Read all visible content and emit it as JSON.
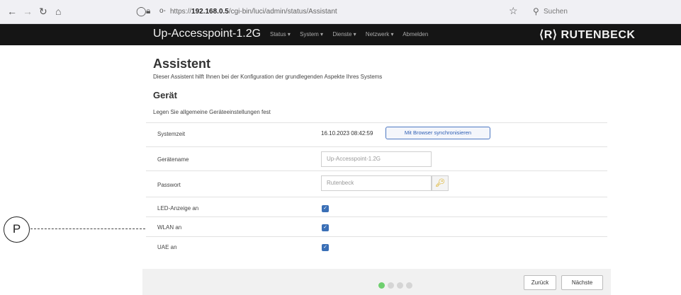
{
  "browser": {
    "url_prefix": "https://",
    "url_host": "192.168.0.5",
    "url_path": "/cgi-bin/luci/admin/status/Assistant",
    "search_placeholder": "Suchen"
  },
  "navbar": {
    "brand": "Up-Accesspoint-1.2G",
    "menu": [
      "Status ▾",
      "System ▾",
      "Dienste ▾",
      "Netzwerk ▾",
      "Abmelden"
    ],
    "logo": "⟨R⟩ RUTENBECK"
  },
  "page": {
    "title": "Assistent",
    "subtitle": "Dieser Assistent hilft Ihnen bei der Konfiguration der grundlegenden Aspekte Ihres Systems",
    "section_title": "Gerät",
    "section_desc": "Legen Sie allgemeine Geräteeinstellungen fest"
  },
  "form": {
    "systemzeit_label": "Systemzeit",
    "systemzeit_value": "16.10.2023 08:42:59",
    "sync_button": "Mit Browser synchronisieren",
    "geraetename_label": "Gerätename",
    "geraetename_value": "Up-Accesspoint-1.2G",
    "passwort_label": "Passwort",
    "passwort_value": "Rutenbeck",
    "led_label": "LED-Anzeige an",
    "led_checked": true,
    "wlan_label": "WLAN an",
    "wlan_checked": true,
    "uae_label": "UAE an",
    "uae_checked": true
  },
  "wizard": {
    "steps_total": 4,
    "current_step": 1,
    "back_button": "Zurück",
    "next_button": "Nächste"
  },
  "annotation": {
    "callout_label": "P"
  },
  "colors": {
    "navbar_bg": "#151515",
    "accent": "#3a6fb6",
    "active_step": "#6fcf6f"
  }
}
